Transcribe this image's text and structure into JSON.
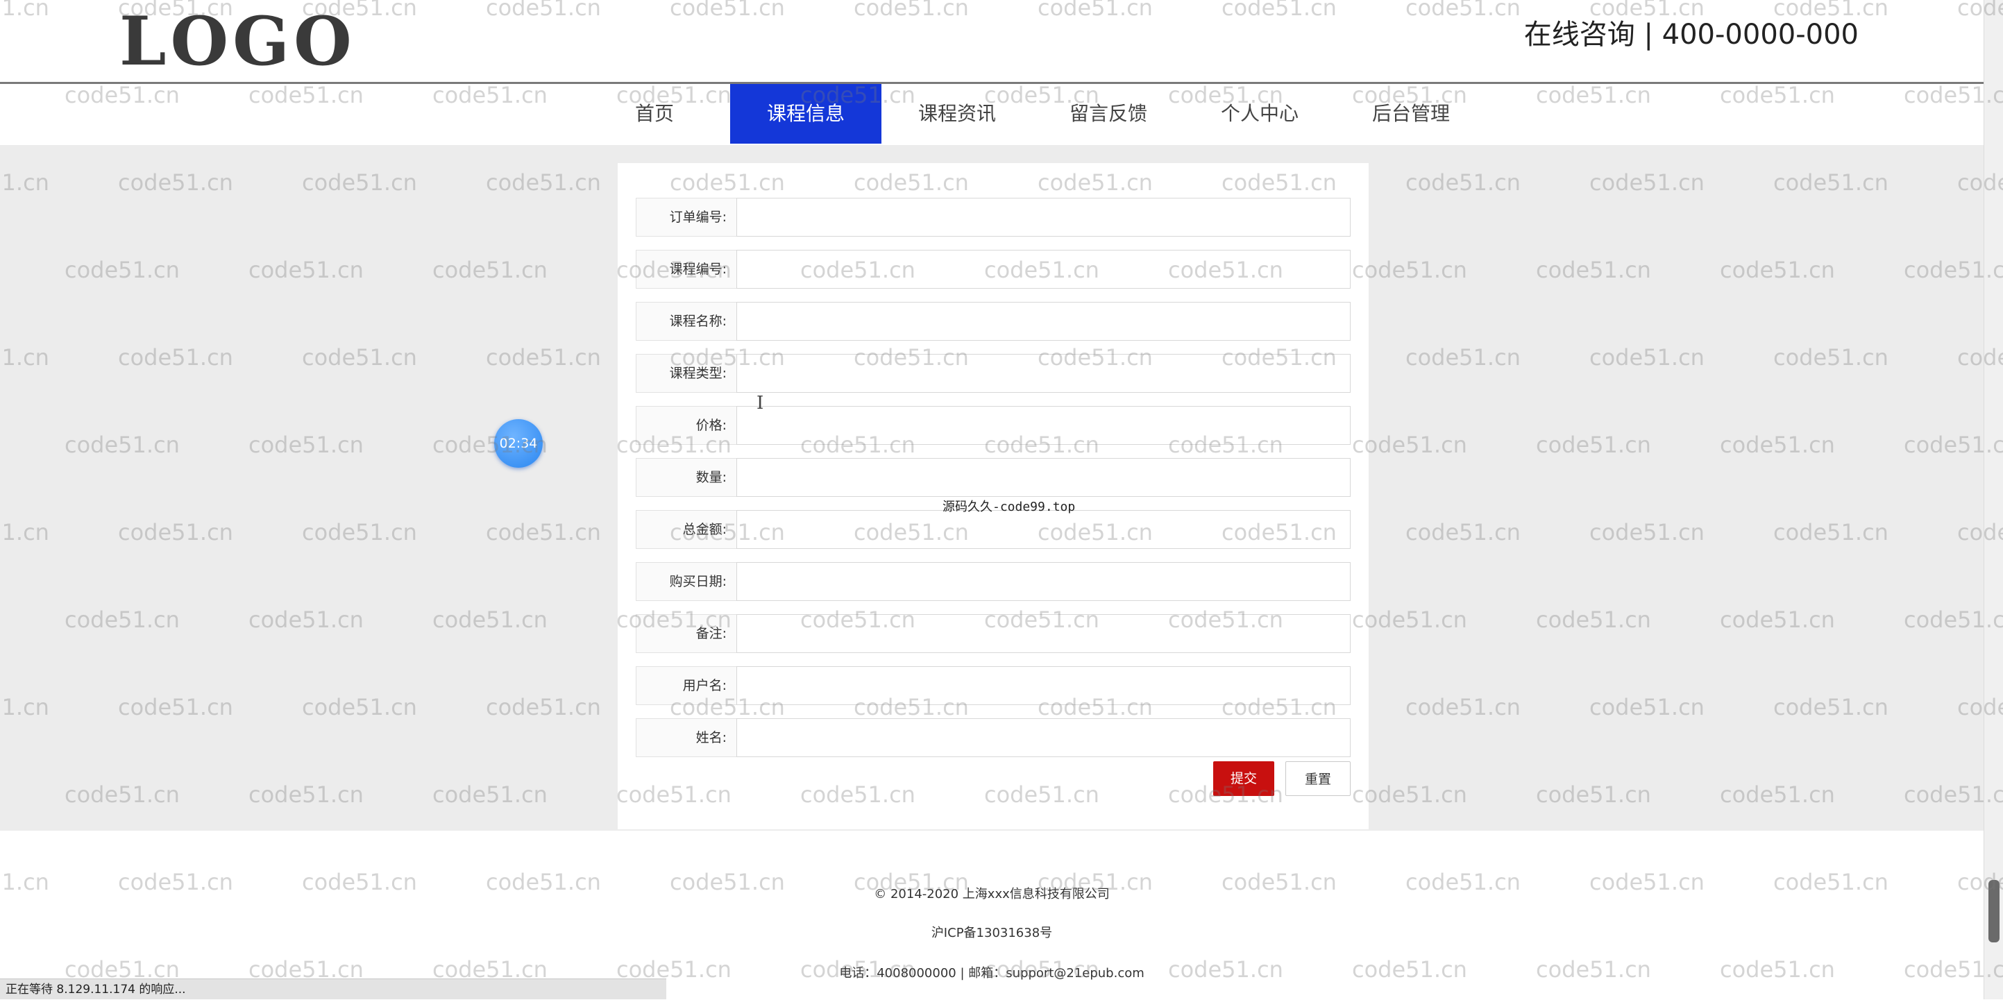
{
  "header": {
    "logo_text": "LOGO",
    "contact_text": "在线咨询 | 400-0000-000"
  },
  "nav": {
    "items": [
      {
        "label": "首页",
        "active": false
      },
      {
        "label": "课程信息",
        "active": true
      },
      {
        "label": "课程资讯",
        "active": false
      },
      {
        "label": "留言反馈",
        "active": false
      },
      {
        "label": "个人中心",
        "active": false
      },
      {
        "label": "后台管理",
        "active": false
      }
    ]
  },
  "form": {
    "fields": [
      {
        "label": "订单编号:",
        "value": ""
      },
      {
        "label": "课程编号:",
        "value": ""
      },
      {
        "label": "课程名称:",
        "value": ""
      },
      {
        "label": "课程类型:",
        "value": ""
      },
      {
        "label": "价格:",
        "value": ""
      },
      {
        "label": "数量:",
        "value": ""
      },
      {
        "label": "总金额:",
        "value": ""
      },
      {
        "label": "购买日期:",
        "value": ""
      },
      {
        "label": "备注:",
        "value": ""
      },
      {
        "label": "用户名:",
        "value": ""
      },
      {
        "label": "姓名:",
        "value": ""
      }
    ],
    "submit_label": "提交",
    "reset_label": "重置"
  },
  "overlay": {
    "center_note": "源码久久-code99.top",
    "timer": "02:34",
    "watermark_text": "code51.cn"
  },
  "footer": {
    "copyright": "© 2014-2020 上海xxx信息科技有限公司",
    "icp": "沪ICP备13031638号",
    "contact": "电话：4008000000 | 邮箱：support@21epub.com"
  },
  "status_bar": {
    "text": "正在等待 8.129.11.174 的响应..."
  },
  "colors": {
    "nav_active": "#1437d8",
    "submit_button": "#c8100f",
    "main_background": "#ececec",
    "timer_bubble": "#2a86f0"
  }
}
